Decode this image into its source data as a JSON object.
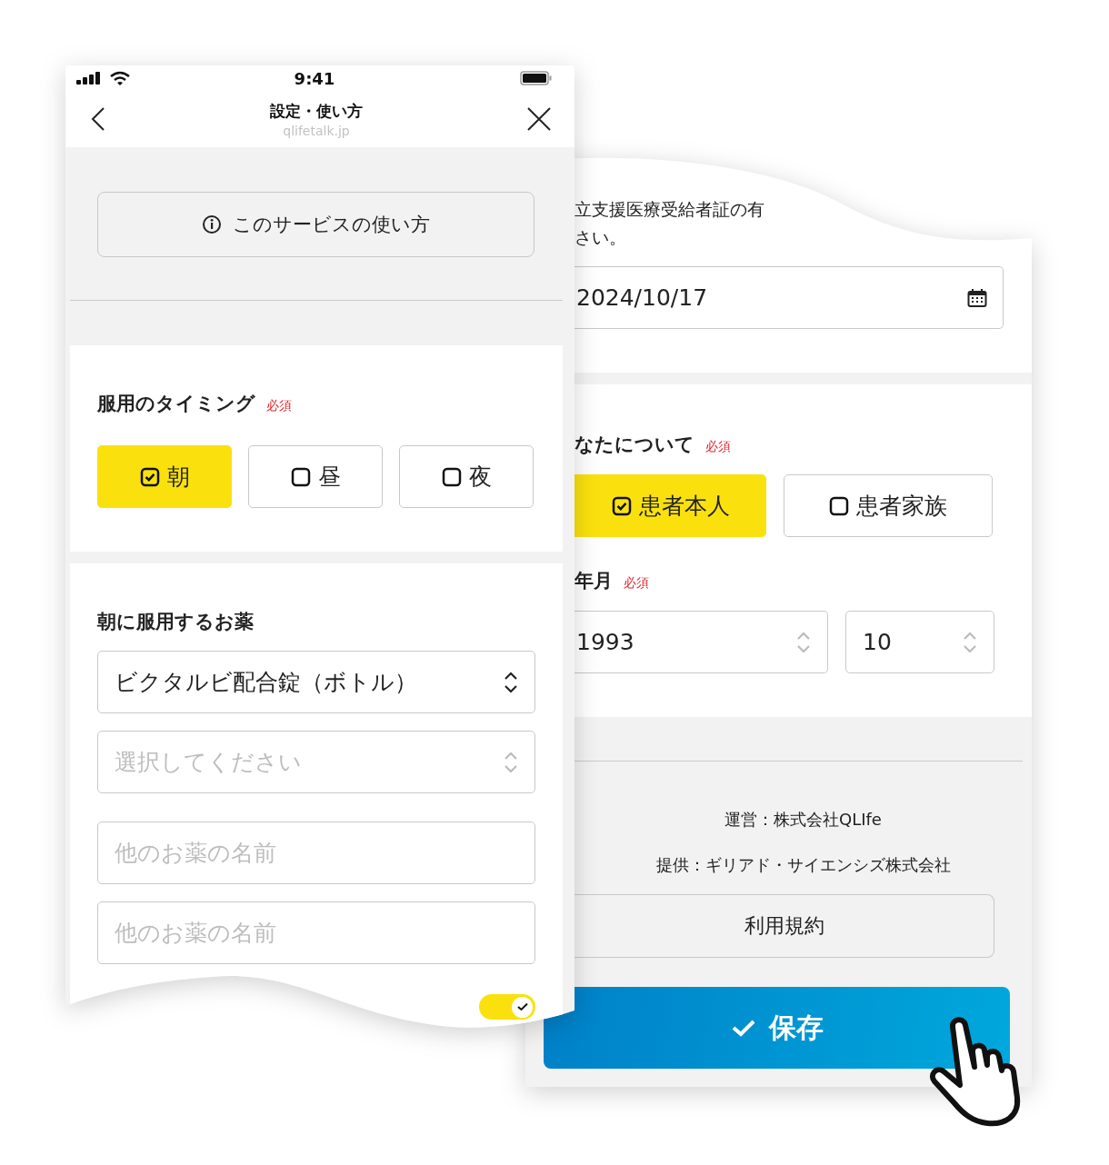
{
  "left_screen": {
    "status_bar": {
      "time": "9:41"
    },
    "header": {
      "title": "設定・使い方",
      "subtitle": "qlifetalk.jp"
    },
    "help_button": {
      "label": "このサービスの使い方"
    },
    "timing": {
      "label": "服用のタイミング",
      "required": "必須",
      "options": [
        {
          "label": "朝",
          "selected": true
        },
        {
          "label": "昼",
          "selected": false
        },
        {
          "label": "夜",
          "selected": false
        }
      ]
    },
    "morning_meds": {
      "label": "朝に服用するお薬",
      "selects": [
        {
          "value": "ビクタルビ配合錠（ボトル）"
        },
        {
          "placeholder": "選択してください"
        }
      ],
      "inputs": [
        {
          "placeholder": "他のお薬の名前"
        },
        {
          "placeholder": "他のお薬の名前"
        }
      ],
      "toggle": {
        "on": true
      }
    }
  },
  "right_screen": {
    "note_lines": [
      "立支援医療受給者証の有",
      "さい。"
    ],
    "date_field": {
      "value": "2024/10/17"
    },
    "about": {
      "label": "なたについて",
      "required": "必須",
      "options": [
        {
          "label": "患者本人",
          "selected": true
        },
        {
          "label": "患者家族",
          "selected": false
        }
      ]
    },
    "birth": {
      "label": "年月",
      "required": "必須",
      "year": "1993",
      "month": "10"
    },
    "footer": {
      "operator": "運営：株式会社QLIfe",
      "provider": "提供：ギリアド・サイエンシズ株式会社",
      "terms_button": "利用規約"
    },
    "save_button": {
      "label": "保存"
    }
  }
}
